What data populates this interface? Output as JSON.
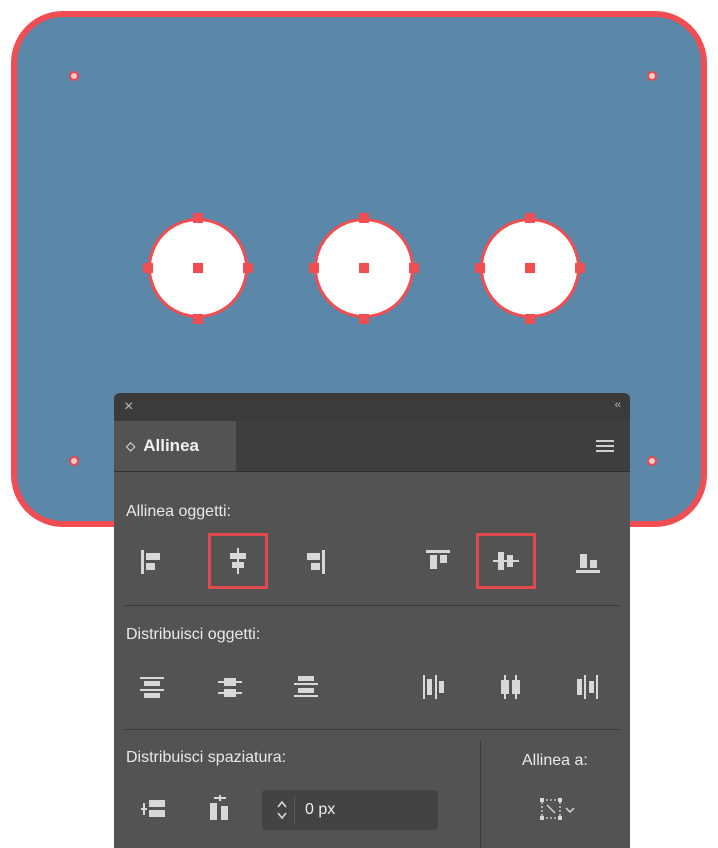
{
  "panel": {
    "close_glyph": "×",
    "collapse_glyph": "‹‹",
    "tab_label": "Allinea",
    "sections": {
      "align_objects_label": "Allinea oggetti:",
      "distribute_objects_label": "Distribuisci oggetti:",
      "distribute_spacing_label": "Distribuisci spaziatura:",
      "align_to_label": "Allinea a:"
    },
    "spacing_value": "0 px",
    "align_buttons": [
      {
        "icon": "align-left-icon",
        "selected": false
      },
      {
        "icon": "align-horizontal-center-icon",
        "selected": true
      },
      {
        "icon": "align-right-icon",
        "selected": false
      },
      {
        "icon": "align-top-icon",
        "selected": false
      },
      {
        "icon": "align-vertical-center-icon",
        "selected": true
      },
      {
        "icon": "align-bottom-icon",
        "selected": false
      }
    ],
    "distribute_buttons": [
      {
        "icon": "distribute-top-icon"
      },
      {
        "icon": "distribute-vertical-center-icon"
      },
      {
        "icon": "distribute-bottom-icon"
      },
      {
        "icon": "distribute-left-icon"
      },
      {
        "icon": "distribute-horizontal-center-icon"
      },
      {
        "icon": "distribute-right-icon"
      }
    ]
  },
  "colors": {
    "shape_fill": "#5b87a8",
    "selection_red": "#f04e53",
    "panel_bg": "#535353"
  }
}
